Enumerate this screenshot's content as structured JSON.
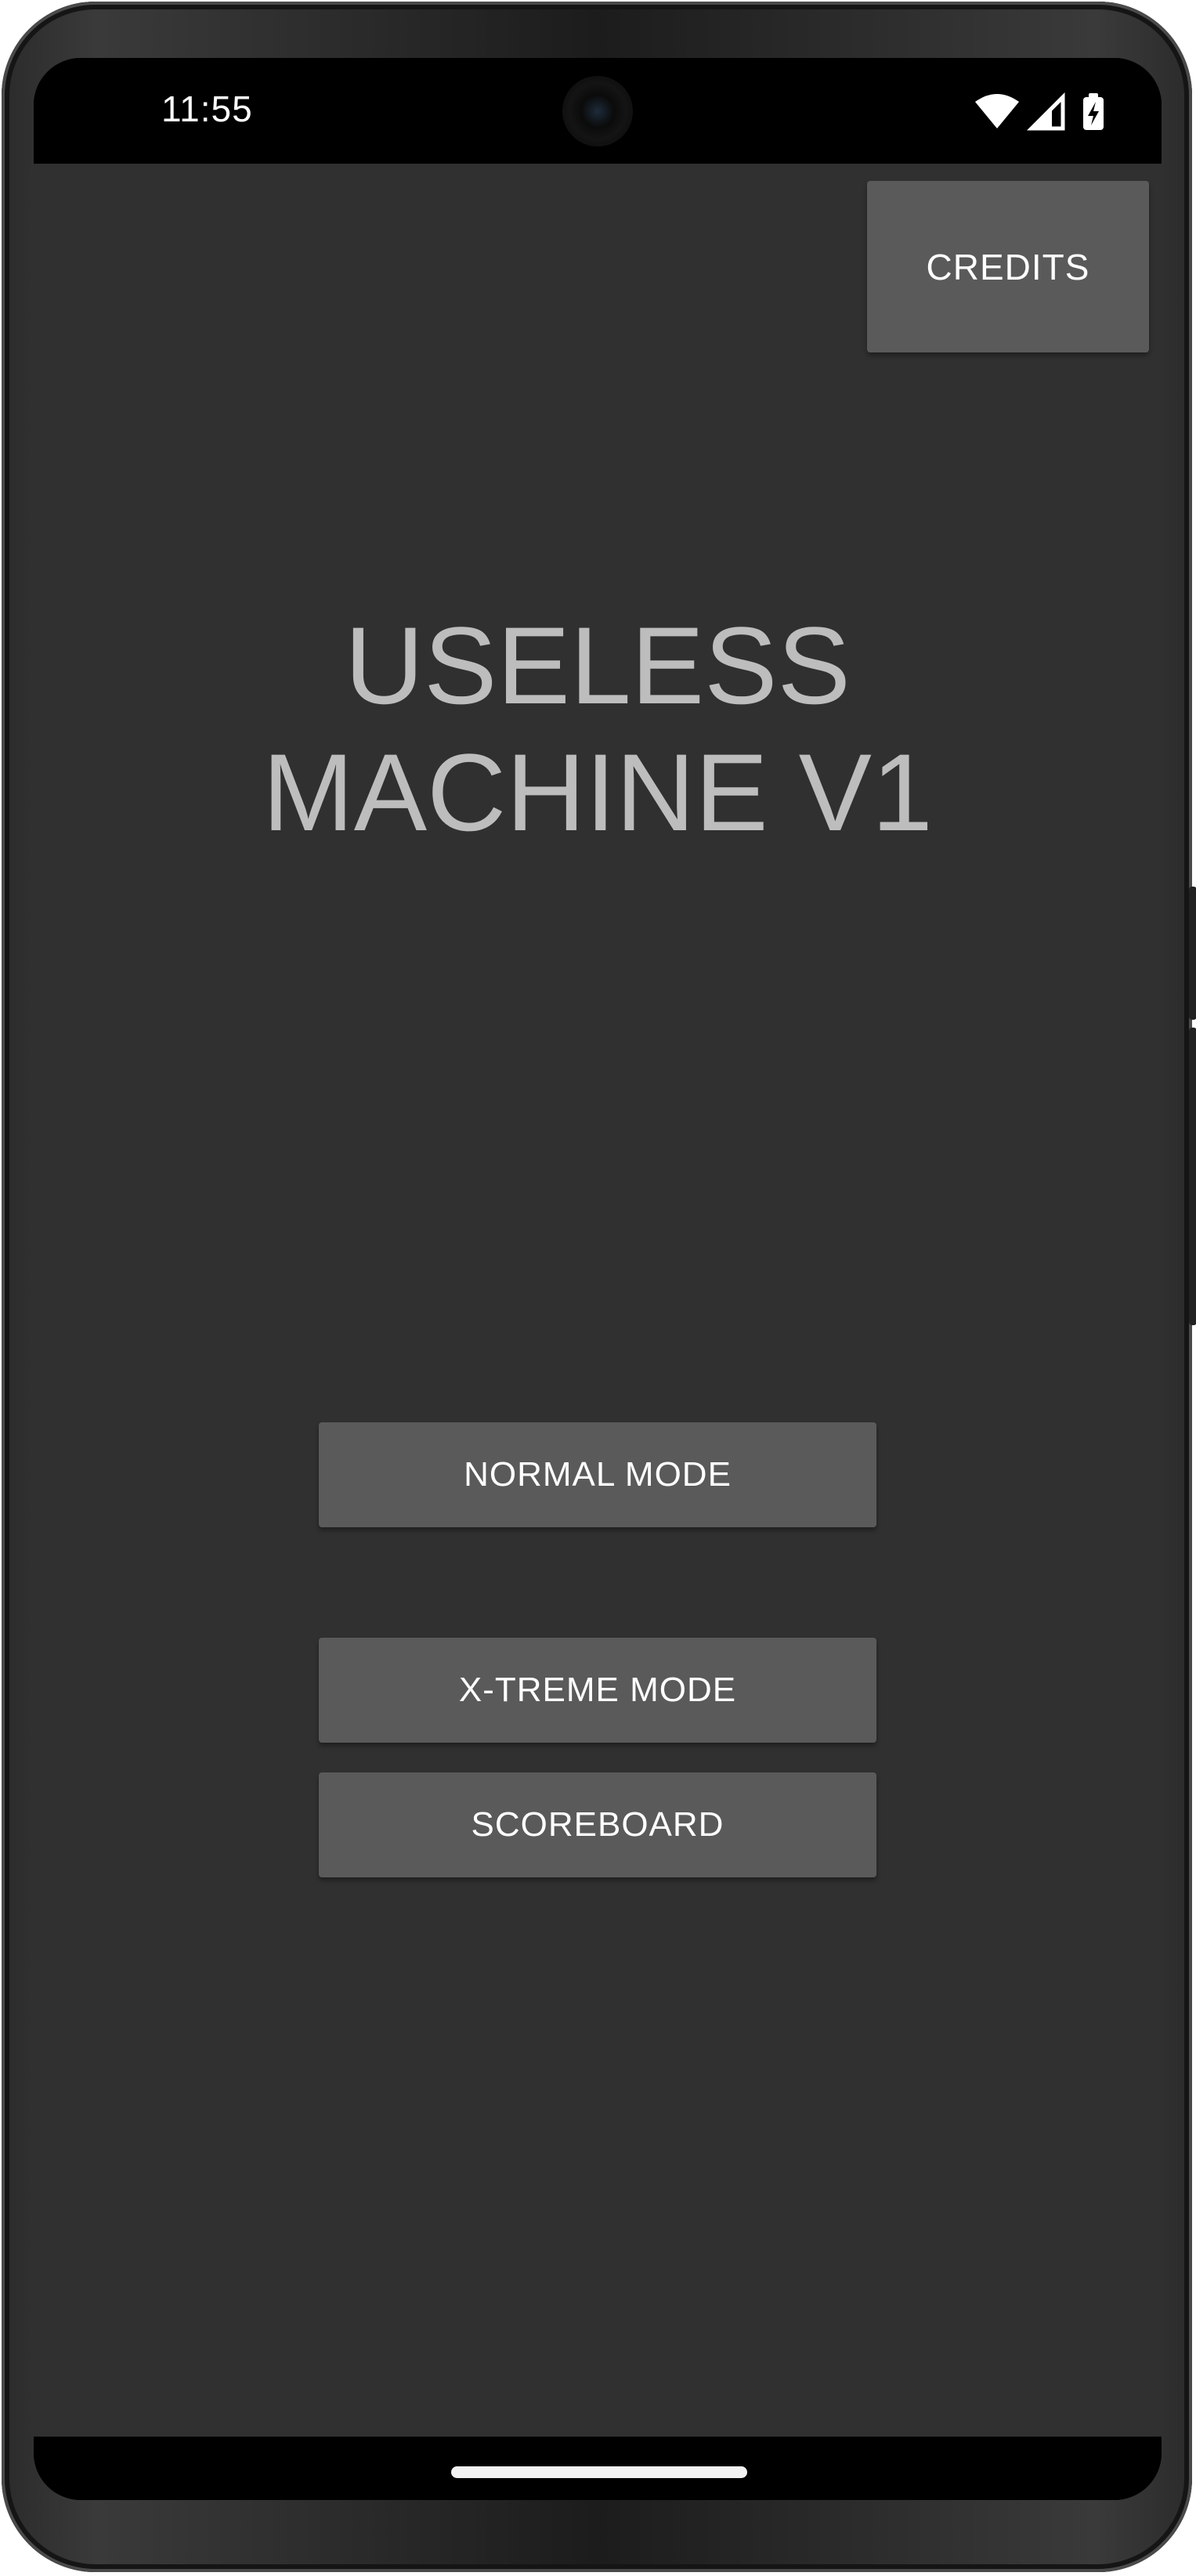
{
  "status_bar": {
    "time": "11:55",
    "icons": [
      "wifi-icon",
      "cellular-signal-icon",
      "battery-charging-icon"
    ]
  },
  "app": {
    "credits_label": "CREDITS",
    "title_line1": "USELESS",
    "title_line2": "MACHINE V1",
    "buttons": {
      "normal_mode": "NORMAL MODE",
      "xtreme_mode": "X-TREME MODE",
      "scoreboard": "SCOREBOARD"
    }
  },
  "colors": {
    "background": "#303030",
    "button": "#5a5a5b",
    "title_text": "#bdbdbd",
    "button_text": "#ffffff"
  }
}
